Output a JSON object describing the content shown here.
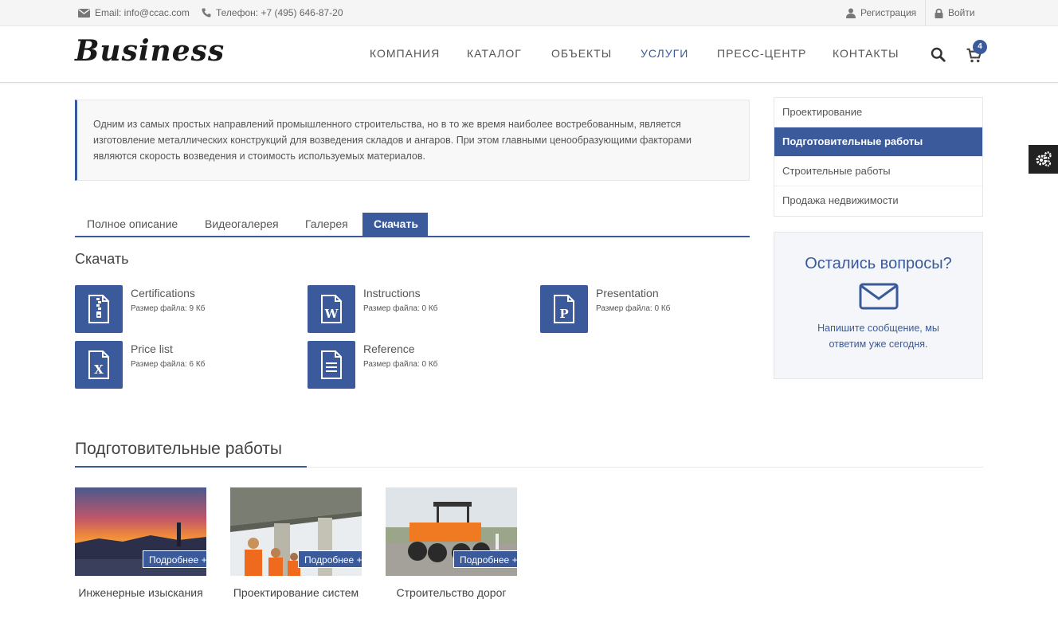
{
  "topbar": {
    "email": "Email: info@ccac.com",
    "phone": "Телефон: +7 (495) 646-87-20",
    "register": "Регистрация",
    "login": "Войти"
  },
  "header": {
    "logo": "Business",
    "nav": [
      "КОМПАНИЯ",
      "КАТАЛОГ",
      "ОБЪЕКТЫ",
      "УСЛУГИ",
      "ПРЕСС-ЦЕНТР",
      "КОНТАКТЫ"
    ],
    "active_nav": "УСЛУГИ",
    "cart_count": "4"
  },
  "intro": {
    "text_lines": [
      "Одним из самых простых направлений промышленного строительства, но в то же время наиболее востребованным, является",
      "изготовление металлических конструкций для возведения складов и ангаров. При этом главными ценообразующими факторами",
      "являются скорость возведения и стоимость используемых материалов."
    ]
  },
  "tabs": [
    "Полное описание",
    "Видеогалерея",
    "Галерея",
    "Скачать"
  ],
  "active_tab": "Скачать",
  "downloads": {
    "title": "Скачать",
    "files": [
      {
        "name": "Certifications",
        "size": "Размер файла: 9 Кб",
        "icon": "zip-file-icon"
      },
      {
        "name": "Instructions",
        "size": "Размер файла: 0 Кб",
        "icon": "word-file-icon"
      },
      {
        "name": "Presentation",
        "size": "Размер файла: 0 Кб",
        "icon": "powerpoint-file-icon"
      },
      {
        "name": "Price list",
        "size": "Размер файла: 6 Кб",
        "icon": "excel-file-icon"
      },
      {
        "name": "Reference",
        "size": "Размер файла: 0 Кб",
        "icon": "text-file-icon"
      }
    ]
  },
  "related": {
    "title": "Подготовительные работы",
    "more_label": "Подробнее +",
    "cards": [
      {
        "caption": "Инженерные изыскания"
      },
      {
        "caption": "Проектирование систем"
      },
      {
        "caption": "Строительство дорог"
      }
    ]
  },
  "sidebar": {
    "items": [
      "Проектирование",
      "Подготовительные работы",
      "Строительные работы",
      "Продажа недвижимости"
    ],
    "active": "Подготовительные работы",
    "ask_title": "Остались вопросы?",
    "ask_text": "Напишите сообщение, мы ответим уже сегодня."
  },
  "colors": {
    "accent": "#3a5a9c",
    "topbar": "#f5f5f5"
  }
}
